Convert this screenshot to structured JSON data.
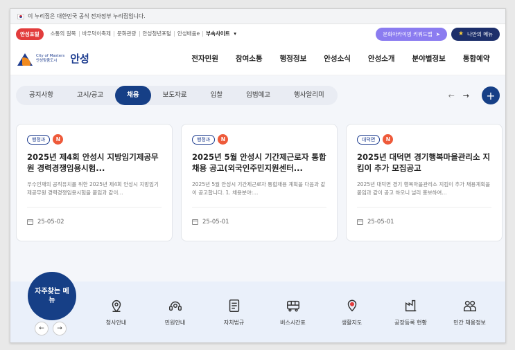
{
  "gov_bar": {
    "text": "이 누리집은 대한민국 공식 전자정부 누리집입니다."
  },
  "util": {
    "portal_label": "안성포털",
    "links": [
      "소통의 길목",
      "바우덕이축제",
      "문화관광",
      "안성청년포털",
      "안성배움e"
    ],
    "sites_label": "부속사이트",
    "archive_button": "문화아카이빙 키워드맵",
    "my_menu_button": "나만의 메뉴"
  },
  "header": {
    "logo_line1": "City of Masters",
    "logo_line2": "안성맞춤도시",
    "logo_name": "안성",
    "gnb": [
      "전자민원",
      "참여소통",
      "행정정보",
      "안성소식",
      "안성소개",
      "분야별정보",
      "통합예약"
    ]
  },
  "tabs": {
    "items": [
      "공지사항",
      "고시/공고",
      "채용",
      "보도자료",
      "입찰",
      "입법예고",
      "행사알리미"
    ],
    "active_index": 2,
    "prev": "←",
    "next": "→",
    "more": "+"
  },
  "cards": [
    {
      "dept": "행정과",
      "new": "N",
      "title": "2025년 제4회 안성시 지방임기제공무원 경력경쟁임용시험...",
      "desc": "우수인재의 공직유치를 위한 2025년 제4회 안성시 지방임기제공무원 경력경쟁임용시험을 붙임과 같이...",
      "date": "25-05-02"
    },
    {
      "dept": "행정과",
      "new": "N",
      "title": "2025년 5월 안성시 기간제근로자 통합채용 공고(외국인주민지원센터...",
      "desc": "2025년 5월 안성시 기간제근로자 통합채용 계획을 다음과 같이 공고합니다. 1. 채용분야:...",
      "date": "25-05-01"
    },
    {
      "dept": "대덕면",
      "new": "N",
      "title": "2025년 대덕면 경기행복마을관리소 지킴이 추가 모집공고",
      "desc": "2025년 대덕면 경기 행복마을관리소 지킴이 추가 채용계획을 붙임과 같이 공고 하오니 널리 홍보하여...",
      "date": "25-05-01"
    }
  ],
  "frequent": {
    "title": "자주찾는 메뉴",
    "prev": "←",
    "next": "→",
    "items": [
      {
        "label": "청사안내",
        "icon": "map-pin-icon"
      },
      {
        "label": "민원안내",
        "icon": "headset-icon"
      },
      {
        "label": "자치법규",
        "icon": "document-icon"
      },
      {
        "label": "버스시간표",
        "icon": "bus-icon"
      },
      {
        "label": "생활지도",
        "icon": "location-icon"
      },
      {
        "label": "공장등록 현황",
        "icon": "factory-icon"
      },
      {
        "label": "민간 채용정보",
        "icon": "people-icon"
      }
    ]
  },
  "colors": {
    "navy": "#163f86",
    "accent_red": "#e23c3c",
    "purple": "#8b7cf0",
    "new_badge": "#ee5a3a"
  }
}
